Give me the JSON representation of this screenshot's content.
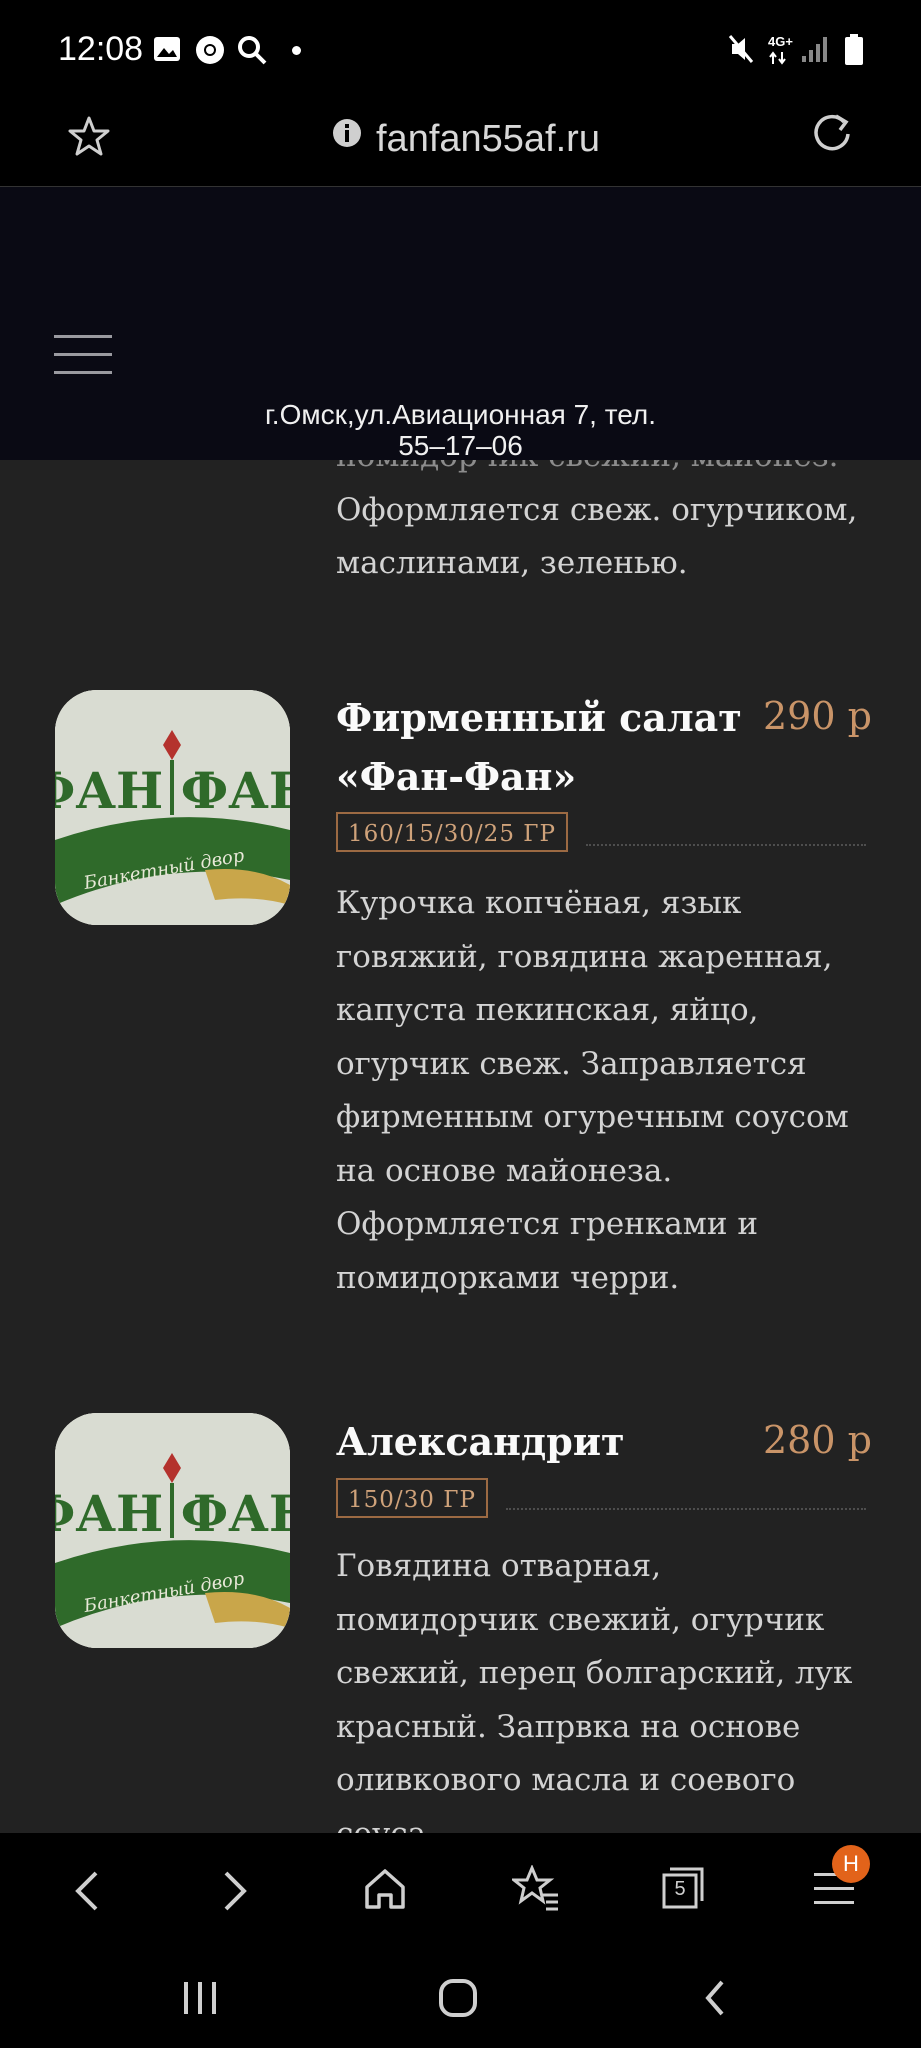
{
  "status_bar": {
    "time": "12:08",
    "network": "4G+",
    "icons": [
      "image-icon",
      "chrome-icon",
      "search-icon",
      "dot-icon",
      "mute-icon",
      "network-icon",
      "signal-icon",
      "battery-icon"
    ]
  },
  "browser": {
    "url": "fanfan55af.ru",
    "bookmark_icon": "star-icon",
    "info_icon": "info-icon",
    "reload_icon": "reload-icon"
  },
  "site": {
    "menu_icon": "hamburger-icon",
    "address_line1": "г.Омск,ул.Авиационная 7, тел.",
    "address_line2": "55–17–06"
  },
  "prev_item": {
    "desc_partial": "помидорчик свежий, майонез.",
    "desc_line2": "Оформляется свеж. огурчиком,",
    "desc_line3": "маслинами, зеленью."
  },
  "items": [
    {
      "title_line1": "Фирменный салат",
      "title_line2": "«Фан-Фан»",
      "price": "290 р",
      "weight": "160/15/30/25 ГР",
      "desc_lines": [
        "Курочка копчёная, язык",
        "говяжий, говядина жаренная,",
        "капуста пекинская, яйцо,",
        "огурчик свеж. Заправляется",
        "фирменным огуречным соусом",
        "на основе майонеза.",
        "Оформляется гренками и",
        "помидорками черри."
      ],
      "logo_text": "ФАН ФАН",
      "logo_ribbon": "Банкетный двор"
    },
    {
      "title_line1": "Александрит",
      "price": "280 р",
      "weight": "150/30 ГР",
      "desc_lines": [
        "Говядина отварная,",
        "помидорчик свежий, огурчик",
        "свежий, перец болгарский, лук",
        "красный. Запрвка на основе",
        "оливкового масла и соевого",
        "соуса."
      ],
      "logo_text": "ФАН ФАН",
      "logo_ribbon": "Банкетный двор"
    }
  ],
  "bottom_nav": {
    "items": [
      "back-icon",
      "forward-icon",
      "home-icon",
      "bookmarks-icon",
      "tabs-icon",
      "menu-icon"
    ],
    "tabs_count": "5",
    "menu_badge": "Н"
  },
  "system_nav": [
    "recents-icon",
    "home-icon",
    "back-icon"
  ]
}
